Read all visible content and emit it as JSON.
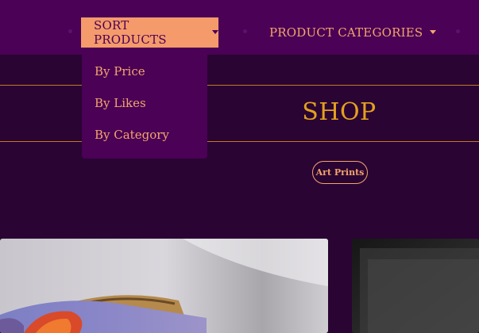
{
  "navbar": {
    "sort_label": "SORT PRODUCTS",
    "categories_label": "PRODUCT CATEGORIES"
  },
  "sort_menu": {
    "items": [
      "By Price",
      "By Likes",
      "By Category"
    ]
  },
  "shop": {
    "title": "SHOP"
  },
  "filters": {
    "active_tag": "Art Prints"
  },
  "colors": {
    "page_bg": "#2a0433",
    "navbar_bg": "#4a0156",
    "accent_peach": "#f59a6b",
    "link_peach": "#f4a56c",
    "title_gold": "#e3a11f",
    "rule_gold": "#c07a24"
  },
  "icons": {
    "caret": "chevron-down-icon"
  }
}
